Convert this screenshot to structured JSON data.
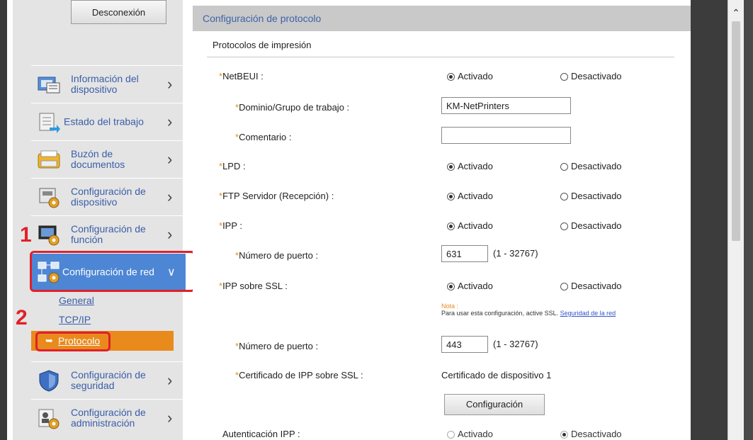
{
  "sidebar": {
    "logout_label": "Desconexión",
    "items": [
      {
        "label": "Información del dispositivo",
        "icon": "device-info-icon"
      },
      {
        "label": "Estado del trabajo",
        "icon": "job-status-icon"
      },
      {
        "label": "Buzón de documentos",
        "icon": "document-box-icon"
      },
      {
        "label": "Configuración de dispositivo",
        "icon": "device-settings-icon"
      },
      {
        "label": "Configuración de función",
        "icon": "function-settings-icon"
      },
      {
        "label": "Configuración de red",
        "icon": "network-settings-icon"
      },
      {
        "label": "Configuración de seguridad",
        "icon": "security-shield-icon"
      },
      {
        "label": "Configuración de administración",
        "icon": "admin-settings-icon"
      }
    ],
    "sub_items": [
      {
        "label": "General"
      },
      {
        "label": "TCP/IP"
      },
      {
        "label": "Protocolo"
      }
    ],
    "steps": [
      "1",
      "2"
    ]
  },
  "main": {
    "header": "Configuración de protocolo",
    "section": "Protocolos de impresión",
    "required_mark": "*",
    "on_label": "Activado",
    "off_label": "Desactivado",
    "rows": {
      "netbeui": "NetBEUI :",
      "domain": "Dominio/Grupo de trabajo :",
      "comment": "Comentario :",
      "lpd": "LPD :",
      "ftp": "FTP Servidor (Recepción) :",
      "ipp": "IPP :",
      "ipp_port": "Número de puerto :",
      "ipp_ssl": "IPP sobre SSL :",
      "ssl_port": "Número de puerto :",
      "ssl_cert": "Certificado de IPP sobre SSL :",
      "ipp_auth": "Autenticación IPP :"
    },
    "values": {
      "domain": "KM-NetPrinters",
      "comment": "",
      "ipp_port": "631",
      "ssl_port": "443",
      "port_range": "(1 - 32767)",
      "ssl_cert": "Certificado de dispositivo 1"
    },
    "note": {
      "title": "Nota :",
      "text": "Para usar esta configuración, active SSL.",
      "link": "Seguridad de la red"
    },
    "config_button": "Configuración"
  },
  "colors": {
    "accent_orange": "#e98a1c",
    "nav_blue": "#4d86d4",
    "link_blue": "#3a5ea8",
    "highlight_red": "#e0202a"
  }
}
